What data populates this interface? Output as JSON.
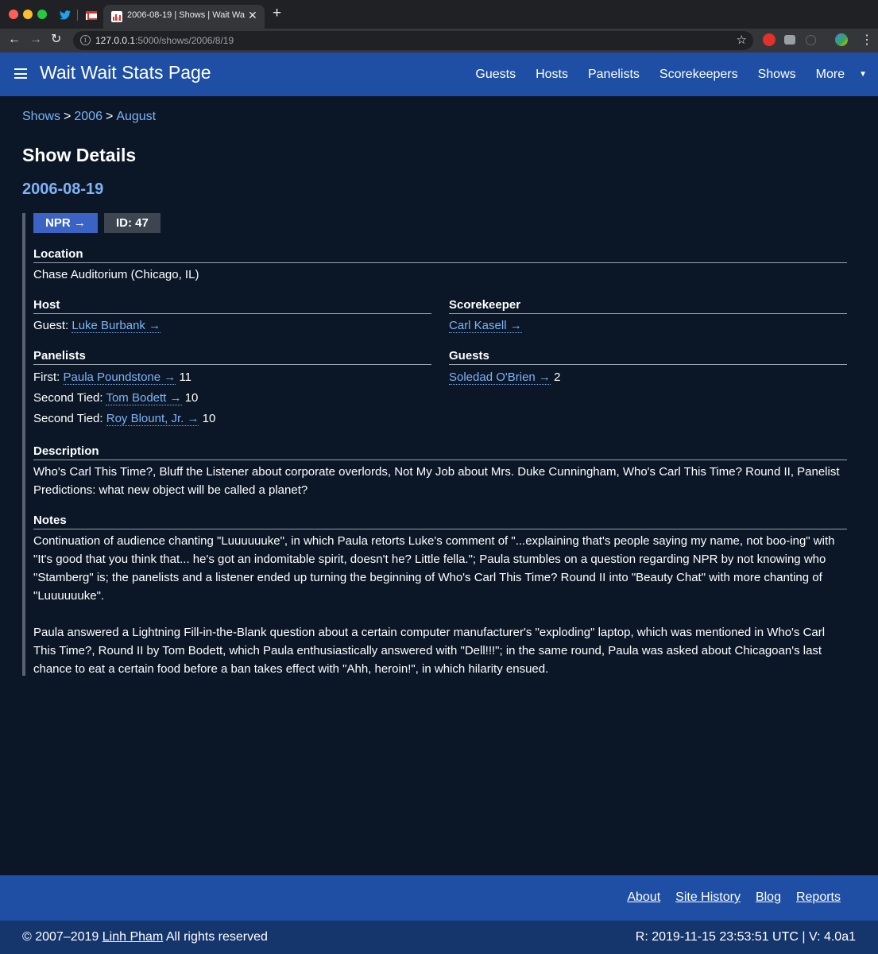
{
  "browser": {
    "tab_title": "2006-08-19 | Shows | Wait Wait",
    "url_host": "127.0.0.1",
    "url_rest": ":5000/shows/2006/8/19"
  },
  "header": {
    "title": "Wait Wait Stats Page",
    "nav": [
      "Guests",
      "Hosts",
      "Panelists",
      "Scorekeepers",
      "Shows",
      "More"
    ]
  },
  "breadcrumb": {
    "items": [
      "Shows",
      "2006",
      "August"
    ],
    "separator": ">"
  },
  "page": {
    "heading": "Show Details",
    "date": "2006-08-19",
    "npr_badge": "NPR →",
    "id_badge": "ID: 47"
  },
  "location": {
    "label": "Location",
    "value": "Chase Auditorium (Chicago, IL)"
  },
  "host": {
    "label": "Host",
    "prefix": "Guest:",
    "name": "Luke Burbank →"
  },
  "scorekeeper": {
    "label": "Scorekeeper",
    "name": "Carl Kasell →"
  },
  "panelists": {
    "label": "Panelists",
    "rows": [
      {
        "rank": "First:",
        "name": "Paula Poundstone →",
        "score": "11"
      },
      {
        "rank": "Second Tied:",
        "name": "Tom Bodett →",
        "score": "10"
      },
      {
        "rank": "Second Tied:",
        "name": "Roy Blount, Jr. →",
        "score": "10"
      }
    ]
  },
  "guests": {
    "label": "Guests",
    "rows": [
      {
        "name": "Soledad O'Brien →",
        "score": "2"
      }
    ]
  },
  "description": {
    "label": "Description",
    "text": "Who's Carl This Time?, Bluff the Listener about corporate overlords, Not My Job about Mrs. Duke Cunningham, Who's Carl This Time? Round II, Panelist Predictions: what new object will be called a planet?"
  },
  "notes": {
    "label": "Notes",
    "paragraph_1": "Continuation of audience chanting \"Luuuuuuke\", in which Paula retorts Luke's comment of \"...explaining that's people saying my name, not boo-ing\" with \"It's good that you think that... he's got an indomitable spirit, doesn't he? Little fella.\"; Paula stumbles on a question regarding NPR by not knowing who \"Stamberg\" is; the panelists and a listener ended up turning the beginning of Who's Carl This Time? Round II into \"Beauty Chat\" with more chanting of \"Luuuuuuke\".",
    "paragraph_2": "Paula answered a Lightning Fill-in-the-Blank question about a certain computer manufacturer's \"exploding\" laptop, which was mentioned in Who's Carl This Time?, Round II by Tom Bodett, which Paula enthusiastically answered with \"Dell!!!\"; in the same round, Paula was asked about Chicagoan's last chance to eat a certain food before a ban takes effect with \"Ahh, heroin!\", in which hilarity ensued."
  },
  "footer": {
    "links": [
      "About",
      "Site History",
      "Blog",
      "Reports"
    ],
    "copyright_prefix": "© 2007–2019",
    "owner": "Linh Pham",
    "copyright_suffix": "All rights reserved",
    "version": "R: 2019-11-15 23:53:51 UTC | V: 4.0a1"
  }
}
